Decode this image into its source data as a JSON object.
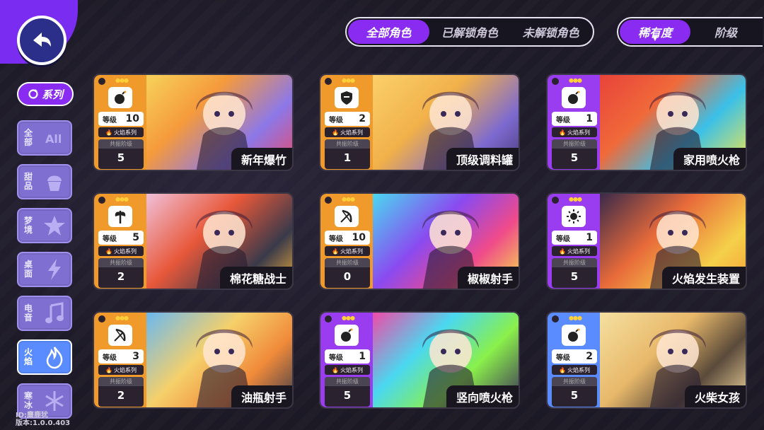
{
  "tabs_ownership": [
    {
      "label": "全部角色",
      "active": true
    },
    {
      "label": "已解锁角色",
      "active": false
    },
    {
      "label": "未解锁角色",
      "active": false
    }
  ],
  "tabs_sort": [
    {
      "label": "稀有度",
      "active": true
    },
    {
      "label": "阶级",
      "active": false
    }
  ],
  "sidebar": {
    "series_label": "系列",
    "items": [
      {
        "label": "全部",
        "icon": "all-icon",
        "active": false
      },
      {
        "label": "甜品",
        "icon": "cupcake-icon",
        "active": false
      },
      {
        "label": "梦境",
        "icon": "star-icon",
        "active": false
      },
      {
        "label": "桌面",
        "icon": "lightning-icon",
        "active": false
      },
      {
        "label": "电音",
        "icon": "music-note-icon",
        "active": false
      },
      {
        "label": "火焰",
        "icon": "flame-icon",
        "active": true
      },
      {
        "label": "寒冰",
        "icon": "snowflake-icon",
        "active": false
      }
    ]
  },
  "footer": {
    "id_text": "ID:麋鹿犹",
    "version_text": "版本:1.0.0.403"
  },
  "card_labels": {
    "level": "等级",
    "series": "火焰系列",
    "resonance": "共振阶级"
  },
  "colors": {
    "orange": "#f09a2c",
    "purple": "#9a3cf0",
    "blue": "#5a8cff",
    "accent": "#8a2bf2"
  },
  "cards": [
    {
      "name": "新年爆竹",
      "level": "10",
      "resonance": "5",
      "rarity": "orange",
      "class_icon": "bomb-icon"
    },
    {
      "name": "顶级调料罐",
      "level": "2",
      "resonance": "1",
      "rarity": "orange",
      "class_icon": "shield-icon"
    },
    {
      "name": "家用喷火枪",
      "level": "1",
      "resonance": "5",
      "rarity": "purple",
      "class_icon": "bomb-icon"
    },
    {
      "name": "棉花糖战士",
      "level": "5",
      "resonance": "2",
      "rarity": "orange",
      "class_icon": "axe-icon"
    },
    {
      "name": "椒椒射手",
      "level": "10",
      "resonance": "0",
      "rarity": "orange",
      "class_icon": "bow-icon"
    },
    {
      "name": "火焰发生装置",
      "level": "1",
      "resonance": "5",
      "rarity": "purple",
      "class_icon": "sun-icon"
    },
    {
      "name": "油瓶射手",
      "level": "3",
      "resonance": "2",
      "rarity": "orange",
      "class_icon": "bow-icon"
    },
    {
      "name": "竖向喷火枪",
      "level": "1",
      "resonance": "5",
      "rarity": "purple",
      "class_icon": "bomb-icon"
    },
    {
      "name": "火柴女孩",
      "level": "2",
      "resonance": "5",
      "rarity": "blue",
      "class_icon": "bomb-icon"
    }
  ]
}
